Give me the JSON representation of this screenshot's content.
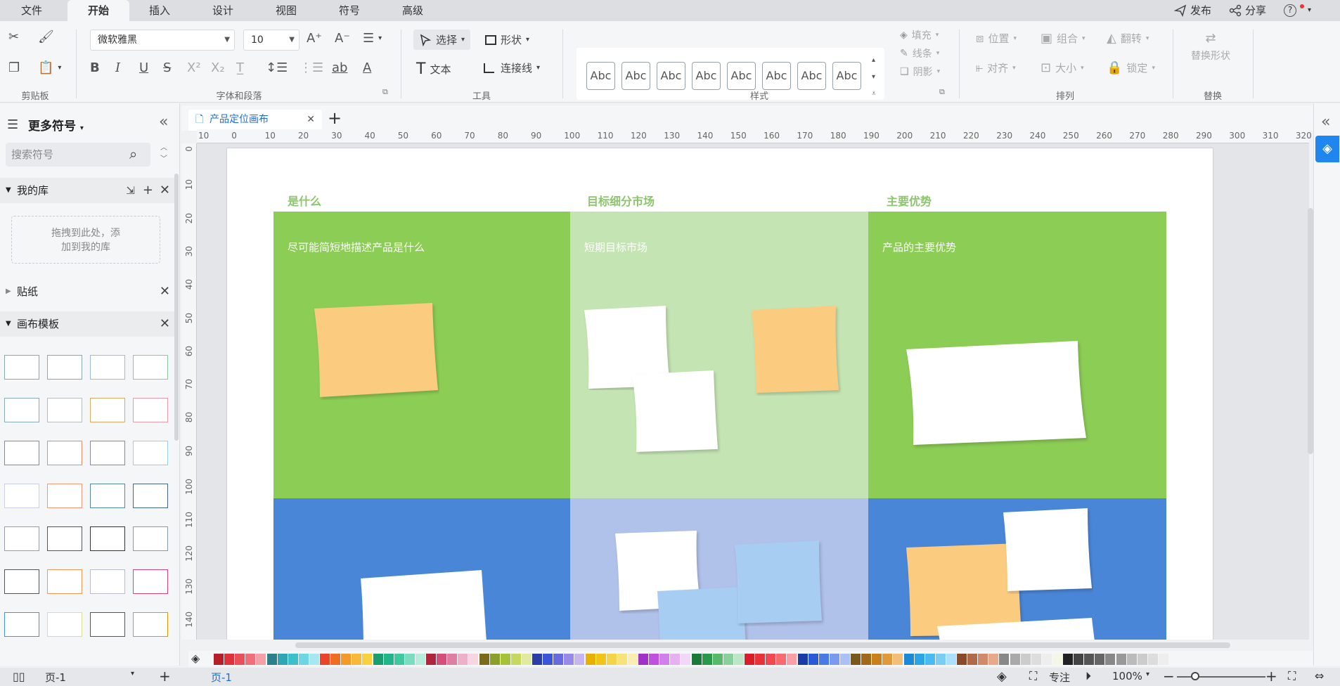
{
  "menubar": {
    "tabs": [
      "文件",
      "开始",
      "插入",
      "设计",
      "视图",
      "符号",
      "高级"
    ],
    "active_tab": "开始",
    "publish": "发布",
    "share": "分享",
    "help": "?"
  },
  "ribbon": {
    "groups": {
      "clipboard": "剪贴板",
      "font_paragraph": "字体和段落",
      "tools": "工具",
      "style": "样式",
      "arrange": "排列",
      "replace": "替换"
    },
    "font_name": "微软雅黑",
    "font_size": "10",
    "select_label": "选择",
    "shape_label": "形状",
    "text_label": "文本",
    "connector_label": "连接线",
    "style_samples": [
      "Abc",
      "Abc",
      "Abc",
      "Abc",
      "Abc",
      "Abc",
      "Abc",
      "Abc"
    ],
    "fill_label": "填充",
    "line_label": "线条",
    "shadow_label": "阴影",
    "position_label": "位置",
    "group_label": "组合",
    "flip_label": "翻转",
    "align_label": "对齐",
    "size_label": "大小",
    "lock_label": "锁定",
    "replace_shape_label": "替换形状"
  },
  "left_panel": {
    "title": "更多符号",
    "search_placeholder": "搜索符号",
    "my_library": "我的库",
    "drop_hint_line1": "拖拽到此处，添",
    "drop_hint_line2": "加到我的库",
    "stickers": "贴纸",
    "canvas_templates": "画布模板"
  },
  "document": {
    "tab_title": "产品定位画布",
    "add_tab": "+",
    "ruler_h": [
      "10",
      "0",
      "10",
      "20",
      "30",
      "40",
      "50",
      "60",
      "70",
      "80",
      "90",
      "100",
      "110",
      "120",
      "130",
      "140",
      "150",
      "160",
      "170",
      "180",
      "190",
      "200",
      "210",
      "220",
      "230",
      "240",
      "250",
      "260",
      "270",
      "280",
      "290",
      "300",
      "310",
      "320"
    ],
    "ruler_v": [
      "0",
      "10",
      "20",
      "30",
      "40",
      "50",
      "60",
      "70",
      "80",
      "90",
      "100",
      "110",
      "120",
      "130",
      "140"
    ]
  },
  "canvas": {
    "columns": [
      {
        "heading": "是什么",
        "text": "尽可能简短地描述产品是什么"
      },
      {
        "heading": "目标细分市场",
        "text": "短期目标市场"
      },
      {
        "heading": "主要优势",
        "text": "产品的主要优势"
      }
    ],
    "colors": {
      "green": "#8ccd55",
      "light_green": "#c5e4b3",
      "blue": "#4a86d8",
      "light_blue": "#b0c1ea",
      "orange_note": "#fbcc80",
      "blue_note": "#a8cdf2",
      "white_note": "#ffffff"
    }
  },
  "statusbar": {
    "page_select": "页-1",
    "add_page": "+",
    "active_page": "页-1",
    "focus": "专注",
    "zoom": "100%"
  }
}
